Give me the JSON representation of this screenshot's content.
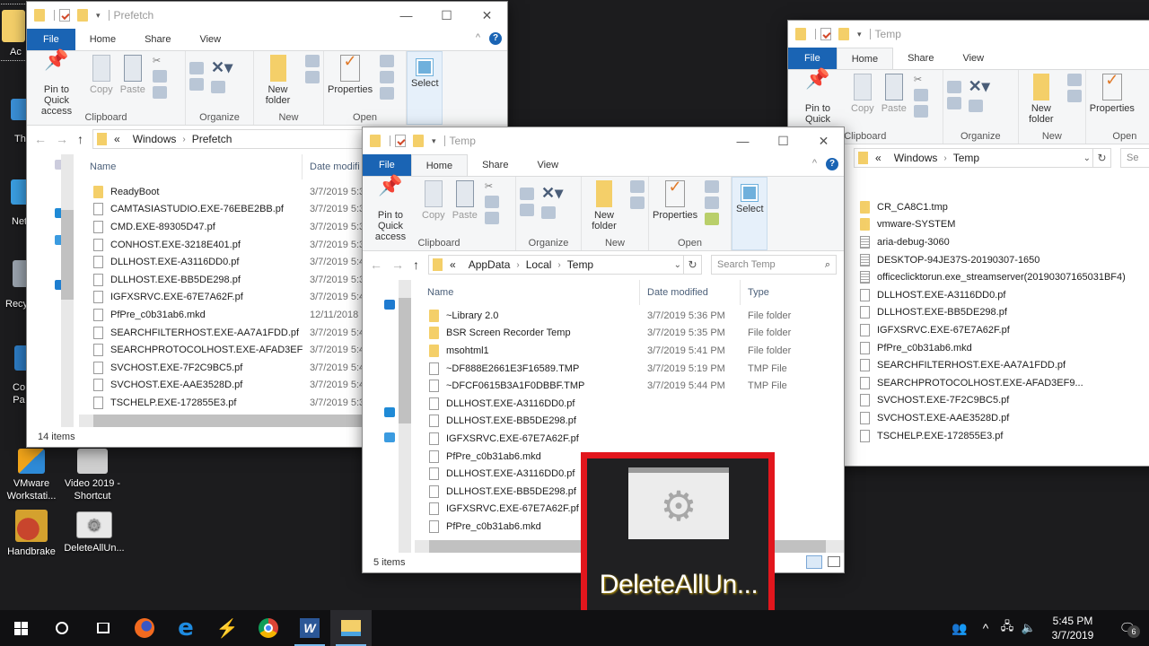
{
  "desktop": {
    "icons": [
      {
        "label": "Ac",
        "icon": "folder-icon"
      },
      {
        "label": "Th",
        "icon": "this-pc-icon"
      },
      {
        "label": "Net",
        "icon": "network-icon"
      },
      {
        "label": "Recy",
        "icon": "recycle-bin-icon"
      },
      {
        "label": "Co\nPa",
        "icon": "control-panel-icon"
      },
      {
        "label": "VMware Workstati...",
        "icon": "vmware-icon"
      },
      {
        "label": "Video 2019 - Shortcut",
        "icon": "video-shortcut-icon"
      },
      {
        "label": "Handbrake",
        "icon": "handbrake-icon"
      },
      {
        "label": "DeleteAllUn...",
        "icon": "gear-app-icon"
      }
    ],
    "highlight": {
      "label": "DeleteAllUn...",
      "border_color": "#e2161d"
    }
  },
  "ribbon": {
    "tabs": [
      "File",
      "Home",
      "Share",
      "View"
    ],
    "pin_label": "Pin to Quick access",
    "copy_label": "Copy",
    "paste_label": "Paste",
    "new_folder_label": "New folder",
    "properties_label": "Properties",
    "select_label": "Select",
    "groups": [
      "Clipboard",
      "Organize",
      "New",
      "Open"
    ]
  },
  "windows": {
    "prefetch": {
      "title": "Prefetch",
      "breadcrumb": [
        "«",
        "Windows",
        "Prefetch"
      ],
      "columns": [
        "Name",
        "Date modifi"
      ],
      "rows": [
        {
          "name": "ReadyBoot",
          "type": "folder",
          "date": "3/7/2019 5:3"
        },
        {
          "name": "CAMTASIASTUDIO.EXE-76EBE2BB.pf",
          "type": "file",
          "date": "3/7/2019 5:3"
        },
        {
          "name": "CMD.EXE-89305D47.pf",
          "type": "file",
          "date": "3/7/2019 5:3"
        },
        {
          "name": "CONHOST.EXE-3218E401.pf",
          "type": "file",
          "date": "3/7/2019 5:3"
        },
        {
          "name": "DLLHOST.EXE-A3116DD0.pf",
          "type": "file",
          "date": "3/7/2019 5:4"
        },
        {
          "name": "DLLHOST.EXE-BB5DE298.pf",
          "type": "file",
          "date": "3/7/2019 5:3"
        },
        {
          "name": "IGFXSRVC.EXE-67E7A62F.pf",
          "type": "file",
          "date": "3/7/2019 5:4"
        },
        {
          "name": "PfPre_c0b31ab6.mkd",
          "type": "file",
          "date": "12/11/2018"
        },
        {
          "name": "SEARCHFILTERHOST.EXE-AA7A1FDD.pf",
          "type": "file",
          "date": "3/7/2019 5:4"
        },
        {
          "name": "SEARCHPROTOCOLHOST.EXE-AFAD3EF9...",
          "type": "file",
          "date": "3/7/2019 5:4"
        },
        {
          "name": "SVCHOST.EXE-7F2C9BC5.pf",
          "type": "file",
          "date": "3/7/2019 5:4"
        },
        {
          "name": "SVCHOST.EXE-AAE3528D.pf",
          "type": "file",
          "date": "3/7/2019 5:4"
        },
        {
          "name": "TSCHELP.EXE-172855E3.pf",
          "type": "file",
          "date": "3/7/2019 5:3"
        }
      ],
      "status": "14 items"
    },
    "temp_local": {
      "title": "Temp",
      "breadcrumb": [
        "«",
        "AppData",
        "Local",
        "Temp"
      ],
      "search_placeholder": "Search Temp",
      "columns": [
        "Name",
        "Date modified",
        "Type"
      ],
      "rows": [
        {
          "name": "~Library 2.0",
          "type_icon": "folder",
          "date": "3/7/2019 5:36 PM",
          "type": "File folder"
        },
        {
          "name": "BSR Screen Recorder Temp",
          "type_icon": "folder",
          "date": "3/7/2019 5:35 PM",
          "type": "File folder"
        },
        {
          "name": "msohtml1",
          "type_icon": "folder",
          "date": "3/7/2019 5:41 PM",
          "type": "File folder"
        },
        {
          "name": "~DF888E2661E3F16589.TMP",
          "type_icon": "file",
          "date": "3/7/2019 5:19 PM",
          "type": "TMP File"
        },
        {
          "name": "~DFCF0615B3A1F0DBBF.TMP",
          "type_icon": "file",
          "date": "3/7/2019 5:44 PM",
          "type": "TMP File"
        },
        {
          "name": "DLLHOST.EXE-A3116DD0.pf",
          "type_icon": "file",
          "date": "",
          "type": ""
        },
        {
          "name": "DLLHOST.EXE-BB5DE298.pf",
          "type_icon": "file",
          "date": "",
          "type": ""
        },
        {
          "name": "IGFXSRVC.EXE-67E7A62F.pf",
          "type_icon": "file",
          "date": "",
          "type": ""
        },
        {
          "name": "PfPre_c0b31ab6.mkd",
          "type_icon": "file",
          "date": "",
          "type": ""
        },
        {
          "name": "DLLHOST.EXE-A3116DD0.pf",
          "type_icon": "file",
          "date": "",
          "type": ""
        },
        {
          "name": "DLLHOST.EXE-BB5DE298.pf",
          "type_icon": "file",
          "date": "",
          "type": ""
        },
        {
          "name": "IGFXSRVC.EXE-67E7A62F.pf",
          "type_icon": "file",
          "date": "",
          "type": ""
        },
        {
          "name": "PfPre_c0b31ab6.mkd",
          "type_icon": "file",
          "date": "",
          "type": ""
        }
      ],
      "status": "5 items"
    },
    "temp_windows": {
      "title": "Temp",
      "breadcrumb": [
        "«",
        "Windows",
        "Temp"
      ],
      "search_placeholder": "Se",
      "rows": [
        {
          "name": "CR_CA8C1.tmp",
          "type_icon": "folder"
        },
        {
          "name": "vmware-SYSTEM",
          "type_icon": "folder"
        },
        {
          "name": "aria-debug-3060",
          "type_icon": "text"
        },
        {
          "name": "DESKTOP-94JE37S-20190307-1650",
          "type_icon": "text"
        },
        {
          "name": "officeclicktorun.exe_streamserver(20190307165031BF4)",
          "type_icon": "text"
        },
        {
          "name": "DLLHOST.EXE-A3116DD0.pf",
          "type_icon": "file"
        },
        {
          "name": "DLLHOST.EXE-BB5DE298.pf",
          "type_icon": "file"
        },
        {
          "name": "IGFXSRVC.EXE-67E7A62F.pf",
          "type_icon": "file"
        },
        {
          "name": "PfPre_c0b31ab6.mkd",
          "type_icon": "file"
        },
        {
          "name": "SEARCHFILTERHOST.EXE-AA7A1FDD.pf",
          "type_icon": "file"
        },
        {
          "name": "SEARCHPROTOCOLHOST.EXE-AFAD3EF9...",
          "type_icon": "file"
        },
        {
          "name": "SVCHOST.EXE-7F2C9BC5.pf",
          "type_icon": "file"
        },
        {
          "name": "SVCHOST.EXE-AAE3528D.pf",
          "type_icon": "file"
        },
        {
          "name": "TSCHELP.EXE-172855E3.pf",
          "type_icon": "file"
        }
      ]
    }
  },
  "taskbar": {
    "items": [
      "start-icon",
      "cortana-icon",
      "task-view-icon",
      "firefox-icon",
      "edge-icon",
      "winamp-icon",
      "chrome-icon",
      "word-icon",
      "file-explorer-icon"
    ],
    "time": "5:45 PM",
    "date": "3/7/2019",
    "notification_count": "6"
  },
  "colors": {
    "accent": "#1a64b4",
    "folder": "#f4cf69",
    "highlight": "#e2161d"
  }
}
